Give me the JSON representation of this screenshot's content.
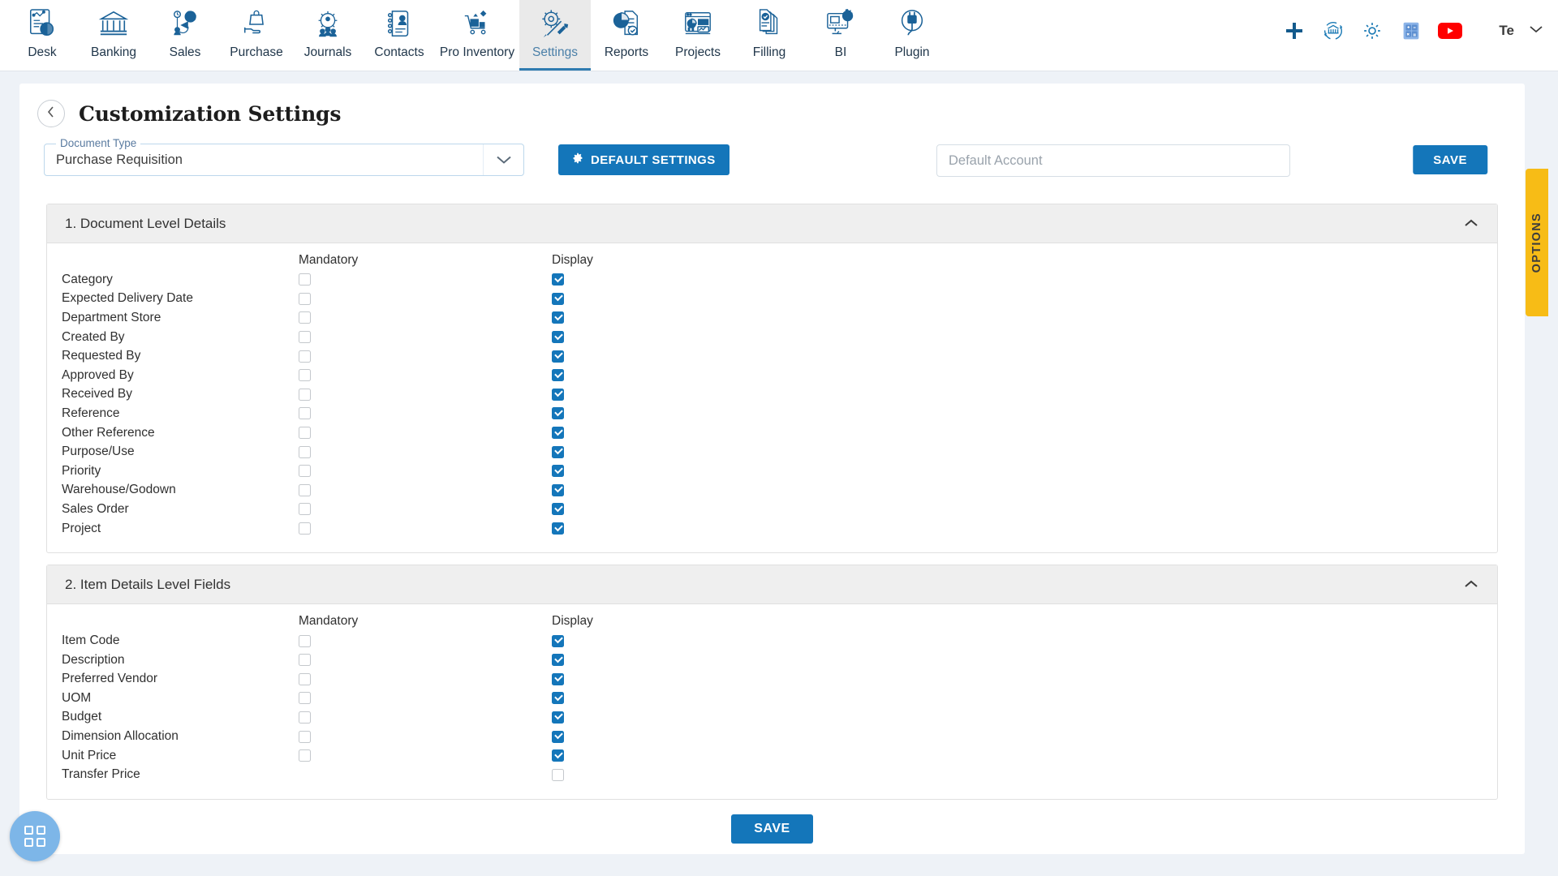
{
  "nav": {
    "items": [
      {
        "label": "Desk",
        "icon": "dashboard-chart-icon",
        "active": false
      },
      {
        "label": "Banking",
        "icon": "bank-building-icon",
        "active": false
      },
      {
        "label": "Sales",
        "icon": "sales-megaphone-icon",
        "active": false
      },
      {
        "label": "Purchase",
        "icon": "purchase-bag-hand-icon",
        "active": false
      },
      {
        "label": "Journals",
        "icon": "journals-gear-people-icon",
        "active": false
      },
      {
        "label": "Contacts",
        "icon": "contacts-book-icon",
        "active": false
      },
      {
        "label": "Pro Inventory",
        "icon": "inventory-cart-icon",
        "active": false
      },
      {
        "label": "Settings",
        "icon": "settings-gear-wrench-icon",
        "active": true
      },
      {
        "label": "Reports",
        "icon": "reports-piechart-doc-icon",
        "active": false
      },
      {
        "label": "Projects",
        "icon": "projects-dashboard-icon",
        "active": false
      },
      {
        "label": "Filling",
        "icon": "filling-documents-check-icon",
        "active": false
      },
      {
        "label": "BI",
        "icon": "bi-monitor-gear-icon",
        "active": false
      },
      {
        "label": "Plugin",
        "icon": "plugin-plug-icon",
        "active": false
      }
    ],
    "right_actions": [
      {
        "icon": "plus-icon",
        "name": "add-new"
      },
      {
        "icon": "bank-sync-icon",
        "name": "bank-sync"
      },
      {
        "icon": "gear-icon",
        "name": "settings-quick"
      },
      {
        "icon": "calculator-icon",
        "name": "calculator"
      },
      {
        "icon": "youtube-icon",
        "name": "youtube-help"
      }
    ],
    "user": {
      "name": "Te",
      "chevron": "chevron-down-icon"
    }
  },
  "header": {
    "back_icon": "chevron-left-icon",
    "title": "Customization Settings"
  },
  "toolbar": {
    "document_type": {
      "label": "Document Type",
      "value": "Purchase Requisition",
      "chevron": "chevron-down-icon"
    },
    "default_settings_button": {
      "label": "DEFAULT SETTINGS",
      "icon": "gear-icon"
    },
    "default_account": {
      "placeholder": "Default Account",
      "value": ""
    },
    "save_button": "SAVE"
  },
  "options_tab": {
    "label": "OPTIONS"
  },
  "fab": {
    "icon": "grid-squares-icon"
  },
  "bottom": {
    "save_button": "SAVE"
  },
  "columns": {
    "field": "",
    "mandatory": "Mandatory",
    "display": "Display"
  },
  "sections": [
    {
      "title": "1. Document Level Details",
      "collapse_icon": "chevron-up-icon",
      "rows": [
        {
          "label": "Category",
          "mandatory": false,
          "display": true,
          "mandatory_present": true,
          "display_present": true
        },
        {
          "label": "Expected Delivery Date",
          "mandatory": false,
          "display": true,
          "mandatory_present": true,
          "display_present": true
        },
        {
          "label": "Department Store",
          "mandatory": false,
          "display": true,
          "mandatory_present": true,
          "display_present": true
        },
        {
          "label": "Created By",
          "mandatory": false,
          "display": true,
          "mandatory_present": true,
          "display_present": true
        },
        {
          "label": "Requested By",
          "mandatory": false,
          "display": true,
          "mandatory_present": true,
          "display_present": true
        },
        {
          "label": "Approved By",
          "mandatory": false,
          "display": true,
          "mandatory_present": true,
          "display_present": true
        },
        {
          "label": "Received By",
          "mandatory": false,
          "display": true,
          "mandatory_present": true,
          "display_present": true
        },
        {
          "label": "Reference",
          "mandatory": false,
          "display": true,
          "mandatory_present": true,
          "display_present": true
        },
        {
          "label": "Other Reference",
          "mandatory": false,
          "display": true,
          "mandatory_present": true,
          "display_present": true
        },
        {
          "label": "Purpose/Use",
          "mandatory": false,
          "display": true,
          "mandatory_present": true,
          "display_present": true
        },
        {
          "label": "Priority",
          "mandatory": false,
          "display": true,
          "mandatory_present": true,
          "display_present": true
        },
        {
          "label": "Warehouse/Godown",
          "mandatory": false,
          "display": true,
          "mandatory_present": true,
          "display_present": true
        },
        {
          "label": "Sales Order",
          "mandatory": false,
          "display": true,
          "mandatory_present": true,
          "display_present": true
        },
        {
          "label": "Project",
          "mandatory": false,
          "display": true,
          "mandatory_present": true,
          "display_present": true
        }
      ]
    },
    {
      "title": "2. Item Details Level Fields",
      "collapse_icon": "chevron-up-icon",
      "rows": [
        {
          "label": "Item Code",
          "mandatory": false,
          "display": true,
          "mandatory_present": true,
          "display_present": true
        },
        {
          "label": "Description",
          "mandatory": false,
          "display": true,
          "mandatory_present": true,
          "display_present": true
        },
        {
          "label": "Preferred Vendor",
          "mandatory": false,
          "display": true,
          "mandatory_present": true,
          "display_present": true
        },
        {
          "label": "UOM",
          "mandatory": false,
          "display": true,
          "mandatory_present": true,
          "display_present": true
        },
        {
          "label": "Budget",
          "mandatory": false,
          "display": true,
          "mandatory_present": true,
          "display_present": true
        },
        {
          "label": "Dimension Allocation",
          "mandatory": false,
          "display": true,
          "mandatory_present": true,
          "display_present": true
        },
        {
          "label": "Unit Price",
          "mandatory": false,
          "display": true,
          "mandatory_present": true,
          "display_present": true
        },
        {
          "label": "Transfer Price",
          "mandatory": false,
          "display": false,
          "mandatory_present": false,
          "display_present": true
        }
      ]
    }
  ],
  "colors": {
    "accent": "#1476ba",
    "nav_icon": "#1b6298",
    "options_tab": "#f7bc16",
    "youtube": "#ff0000",
    "fab": "#7db6e8",
    "section_header": "#efefef"
  }
}
